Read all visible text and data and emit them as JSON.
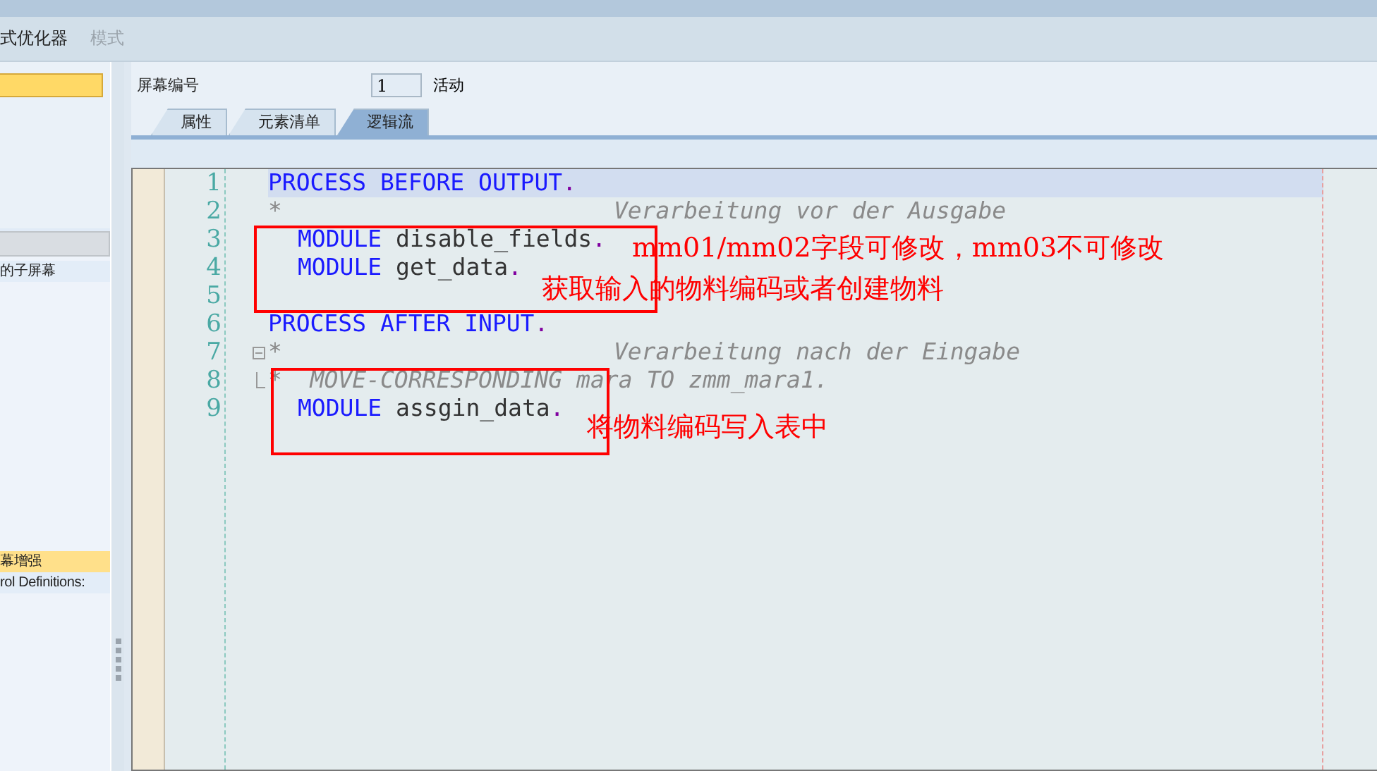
{
  "menu": [
    {
      "label": "式优化器",
      "disabled": false
    },
    {
      "label": "模式",
      "disabled": true
    }
  ],
  "sidebar": {
    "field": {
      "selected": true
    },
    "items": [
      {
        "label": "的子屏幕",
        "selected": false
      },
      {
        "label": "幕增强",
        "selected": true
      },
      {
        "label": "rol Definitions:",
        "selected": false
      }
    ]
  },
  "screen_number": {
    "label": "屏幕编号",
    "value": "1",
    "status": "活动"
  },
  "tabs": [
    {
      "label": "属性",
      "selected": false
    },
    {
      "label": "元素清单",
      "selected": false
    },
    {
      "label": "逻辑流",
      "selected": true
    }
  ],
  "code": [
    {
      "number": "1",
      "current": true,
      "segments": [
        {
          "kind": "keyword",
          "text": "PROCESS BEFORE OUTPUT"
        },
        {
          "kind": "punct",
          "text": "."
        }
      ]
    },
    {
      "number": "2",
      "segments": [
        {
          "kind": "comment",
          "text": "*"
        },
        {
          "kind": "comment_far",
          "text": "Verarbeitung vor der Ausgabe"
        }
      ]
    },
    {
      "number": "3",
      "indented": true,
      "segments": [
        {
          "kind": "keyword",
          "text": "MODULE"
        },
        {
          "kind": "plain",
          "text": " disable_fields"
        },
        {
          "kind": "punct",
          "text": "."
        }
      ]
    },
    {
      "number": "4",
      "indented": true,
      "segments": [
        {
          "kind": "keyword",
          "text": "MODULE"
        },
        {
          "kind": "plain",
          "text": " get_data"
        },
        {
          "kind": "punct",
          "text": "."
        }
      ]
    },
    {
      "number": "5"
    },
    {
      "number": "6",
      "segments": [
        {
          "kind": "keyword",
          "text": "PROCESS AFTER INPUT"
        },
        {
          "kind": "punct",
          "text": "."
        }
      ]
    },
    {
      "number": "7",
      "fold_open": true,
      "segments": [
        {
          "kind": "comment",
          "text": "*"
        },
        {
          "kind": "comment_far",
          "text": "Verarbeitung nach der Eingabe"
        }
      ]
    },
    {
      "number": "8",
      "fold_end": true,
      "segments": [
        {
          "kind": "comment",
          "text": "*  MOVE-CORRESPONDING mara TO zmm_mara1."
        }
      ]
    },
    {
      "number": "9",
      "indented": true,
      "segments": [
        {
          "kind": "keyword",
          "text": "MODULE"
        },
        {
          "kind": "plain",
          "text": " assgin_data"
        },
        {
          "kind": "punct",
          "text": "."
        }
      ]
    }
  ],
  "annotations": [
    {
      "text": "mm01/mm02字段可修改，mm03不可修改"
    },
    {
      "text": "获取输入的物料编码或者创建物料"
    },
    {
      "text": "将物料编码写入表中"
    }
  ]
}
